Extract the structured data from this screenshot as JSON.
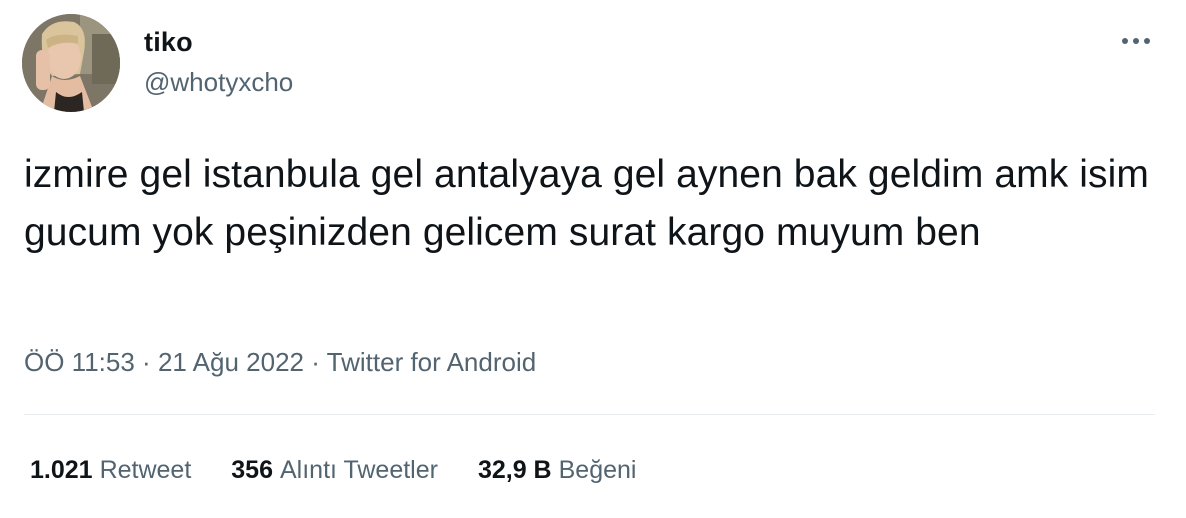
{
  "user": {
    "display_name": "tiko",
    "handle": "@whotyxcho"
  },
  "tweet": {
    "text": "izmire gel istanbula gel antalyaya gel aynen bak geldim amk isim gucum yok peşinizden gelicem surat kargo muyum ben"
  },
  "meta": {
    "time": "ÖÖ 11:53",
    "separator_1": "·",
    "date": "21 Ağu 2022",
    "separator_2": "·",
    "source": "Twitter for Android"
  },
  "stats": {
    "retweets_count": "1.021",
    "retweets_label": "Retweet",
    "quotes_count": "356",
    "quotes_label": "Alıntı Tweetler",
    "likes_count": "32,9 B",
    "likes_label": "Beğeni"
  },
  "icons": {
    "more": "more-horizontal-icon"
  },
  "colors": {
    "primary_text": "#0f1419",
    "secondary_text": "#536471",
    "divider": "#e9ecee"
  }
}
